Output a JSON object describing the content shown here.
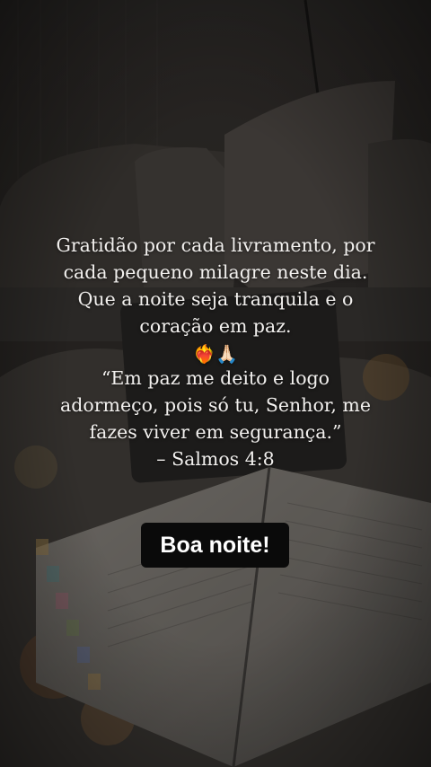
{
  "caption": {
    "line1": "Gratidão por cada livramento, por",
    "line2": "cada pequeno milagre neste dia.",
    "line3": "Que a noite seja tranquila e o",
    "line4": "coração em paz.",
    "emoji_heart": "❤️‍🔥",
    "emoji_pray": "🙏🏻",
    "verse_line1": "“Em paz me deito e logo",
    "verse_line2": "adormeço, pois só tu, Senhor, me",
    "verse_line3": "fazes viver em segurança.”",
    "reference": "– Salmos 4:8"
  },
  "badge": {
    "label": "Boa noite!"
  },
  "background": {
    "description_colors": {
      "wall": "#3a3633",
      "sofa": "#4a4541",
      "pillow": "#55504b",
      "book_pages": "#8a857e",
      "overlay": "#000000"
    }
  }
}
